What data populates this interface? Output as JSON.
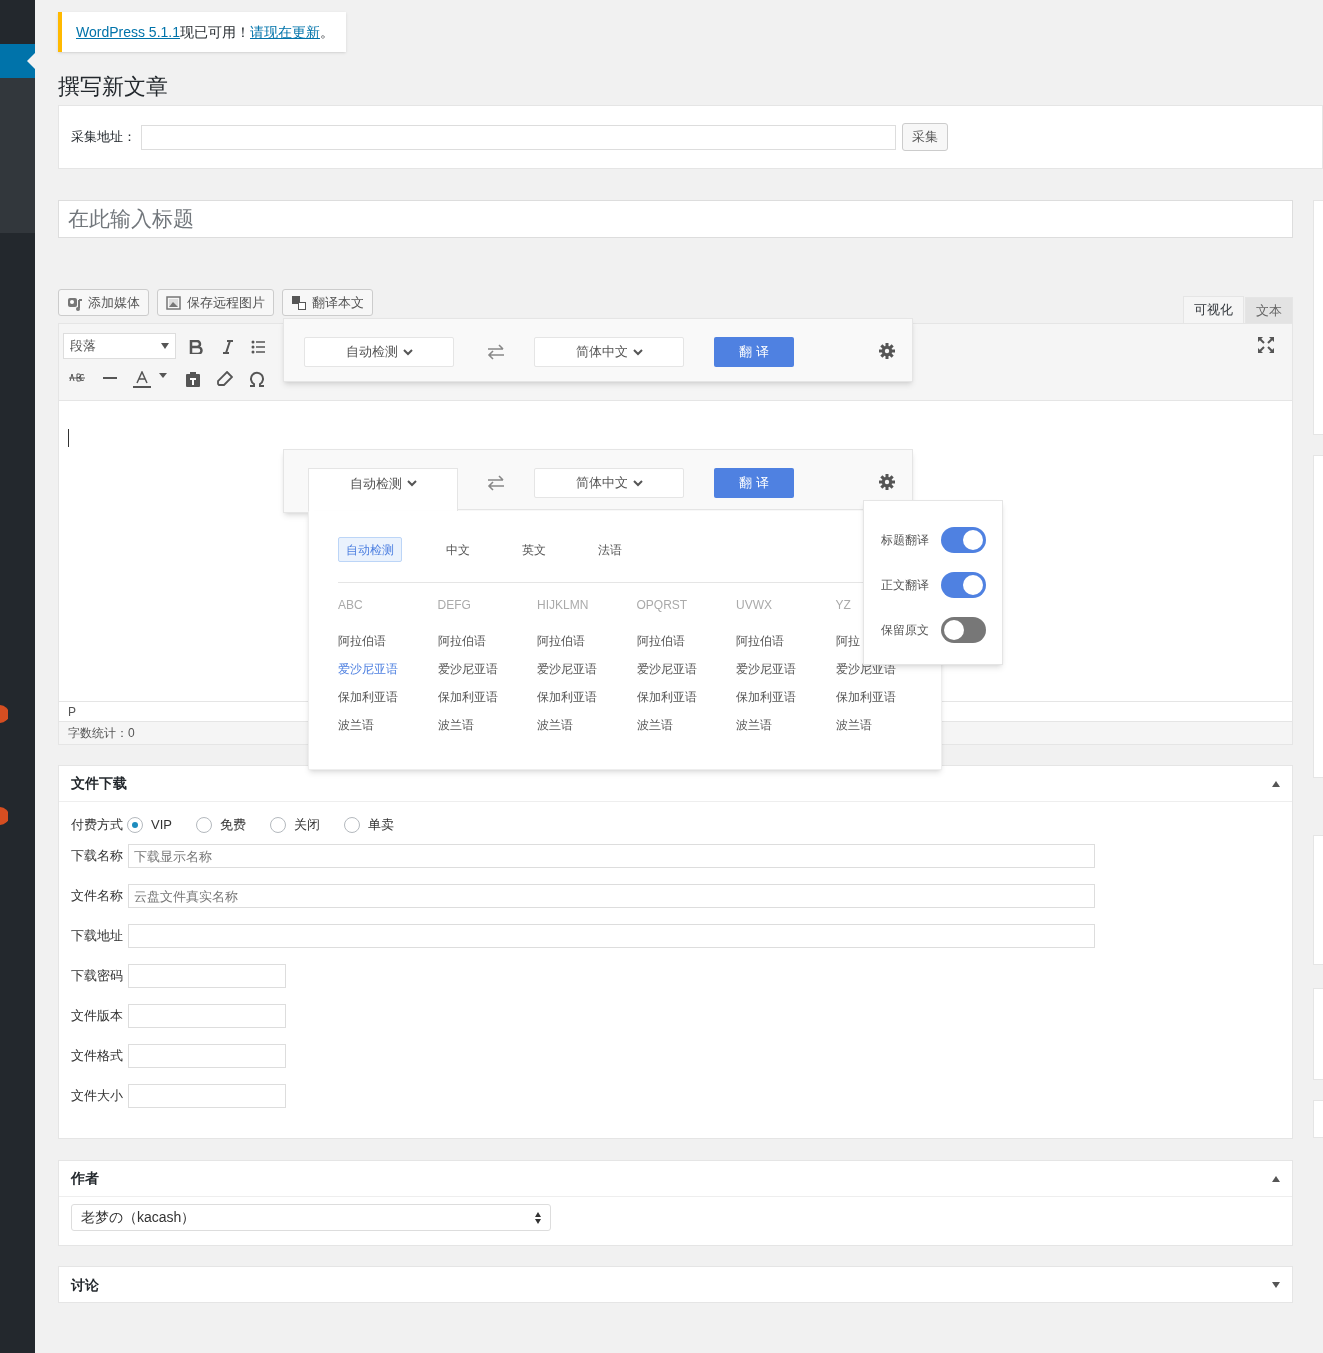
{
  "notice": {
    "link": "WordPress 5.1.1",
    "text": "现已可用！",
    "update_link": "请现在更新",
    "end": "。"
  },
  "page_title": "撰写新文章",
  "collect": {
    "label": "采集地址：",
    "button": "采集"
  },
  "title_placeholder": "在此输入标题",
  "media_buttons": [
    "添加媒体",
    "保存远程图片",
    "翻译本文"
  ],
  "editor_tabs": [
    {
      "label": "可视化",
      "selected": true
    },
    {
      "label": "文本",
      "selected": false
    }
  ],
  "format_select": "段落",
  "path": "P",
  "word_count": "字数统计：0",
  "translate_bars": [
    {
      "from": "自动检测",
      "to": "简体中文",
      "button": "翻 译",
      "open": false
    },
    {
      "from": "自动检测",
      "to": "简体中文",
      "button": "翻 译",
      "open": true
    }
  ],
  "lang_dropdown": {
    "quick": [
      {
        "label": "自动检测",
        "selected": true
      },
      {
        "label": "中文",
        "selected": false
      },
      {
        "label": "英文",
        "selected": false
      },
      {
        "label": "法语",
        "selected": false
      }
    ],
    "columns": [
      {
        "heading": "ABC",
        "items": [
          {
            "label": "阿拉伯语",
            "selected": false
          },
          {
            "label": "爱沙尼亚语",
            "selected": true
          },
          {
            "label": "保加利亚语",
            "selected": false
          },
          {
            "label": "波兰语",
            "selected": false
          }
        ]
      },
      {
        "heading": "DEFG",
        "items": [
          {
            "label": "阿拉伯语",
            "selected": false
          },
          {
            "label": "爱沙尼亚语",
            "selected": false
          },
          {
            "label": "保加利亚语",
            "selected": false
          },
          {
            "label": "波兰语",
            "selected": false
          }
        ]
      },
      {
        "heading": "HIJKLMN",
        "items": [
          {
            "label": "阿拉伯语",
            "selected": false
          },
          {
            "label": "爱沙尼亚语",
            "selected": false
          },
          {
            "label": "保加利亚语",
            "selected": false
          },
          {
            "label": "波兰语",
            "selected": false
          }
        ]
      },
      {
        "heading": "OPQRST",
        "items": [
          {
            "label": "阿拉伯语",
            "selected": false
          },
          {
            "label": "爱沙尼亚语",
            "selected": false
          },
          {
            "label": "保加利亚语",
            "selected": false
          },
          {
            "label": "波兰语",
            "selected": false
          }
        ]
      },
      {
        "heading": "UVWX",
        "items": [
          {
            "label": "阿拉伯语",
            "selected": false
          },
          {
            "label": "爱沙尼亚语",
            "selected": false
          },
          {
            "label": "保加利亚语",
            "selected": false
          },
          {
            "label": "波兰语",
            "selected": false
          }
        ]
      },
      {
        "heading": "YZ",
        "items": [
          {
            "label": "阿拉",
            "selected": false
          },
          {
            "label": "爱沙尼亚语",
            "selected": false
          },
          {
            "label": "保加利亚语",
            "selected": false
          },
          {
            "label": "波兰语",
            "selected": false
          }
        ]
      }
    ]
  },
  "settings": [
    {
      "label": "标题翻译",
      "on": true
    },
    {
      "label": "正文翻译",
      "on": true
    },
    {
      "label": "保留原文",
      "on": false
    }
  ],
  "download": {
    "title": "文件下载",
    "expanded": true,
    "pay_label": "付费方式",
    "pay_options": [
      {
        "label": "VIP",
        "selected": true
      },
      {
        "label": "免费",
        "selected": false
      },
      {
        "label": "关闭",
        "selected": false
      },
      {
        "label": "单卖",
        "selected": false
      }
    ],
    "fields": [
      {
        "label": "下载名称",
        "placeholder": "下载显示名称",
        "kind": "wide"
      },
      {
        "label": "文件名称",
        "placeholder": "云盘文件真实名称",
        "kind": "wide"
      },
      {
        "label": "下载地址",
        "kind": "wide"
      },
      {
        "label": "下载密码",
        "kind": "short"
      },
      {
        "label": "文件版本",
        "kind": "short"
      },
      {
        "label": "文件格式",
        "kind": "short"
      },
      {
        "label": "文件大小",
        "kind": "short"
      }
    ]
  },
  "author": {
    "title": "作者",
    "expanded": true,
    "value": "老梦の（kacash）"
  },
  "discussion": {
    "title": "讨论",
    "expanded": false
  }
}
